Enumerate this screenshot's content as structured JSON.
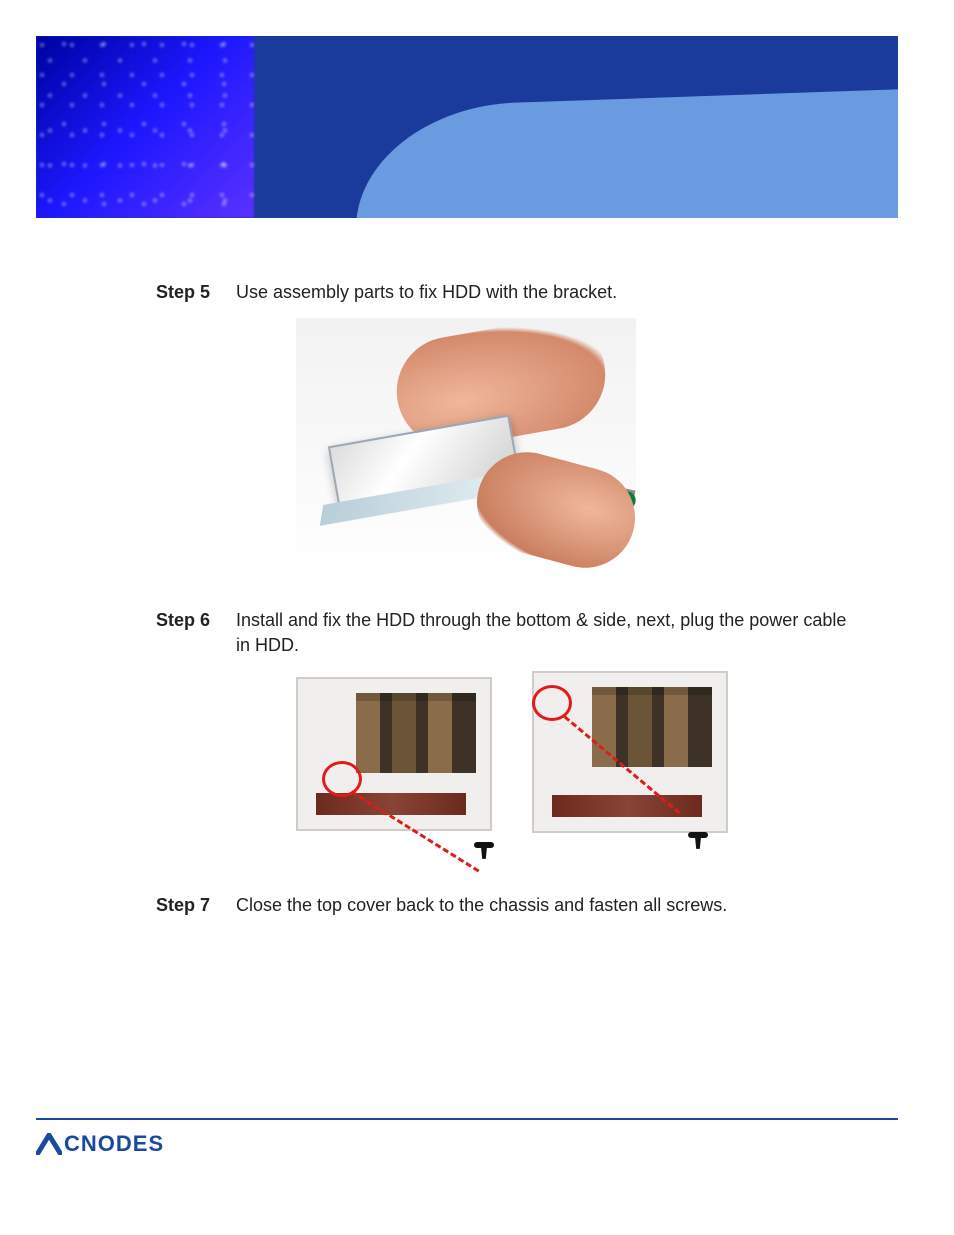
{
  "brand": {
    "logo_text": "CNODES",
    "logo_color": "#1a4aa0"
  },
  "steps": [
    {
      "label": "Step 5",
      "text": "Use assembly parts to fix HDD with the bracket."
    },
    {
      "label": "Step 6",
      "text": "Install and fix the HDD through the bottom & side, next, plug the power cable in HDD."
    },
    {
      "label": "Step 7",
      "text": "Close the top cover back to the chassis and fasten all screws."
    }
  ]
}
